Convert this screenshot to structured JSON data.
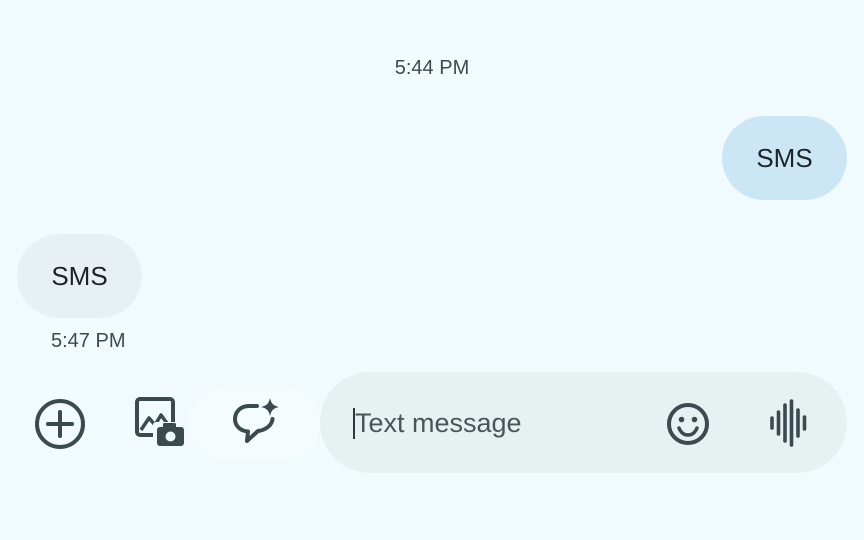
{
  "conversation": {
    "messages": [
      {
        "direction": "outgoing",
        "timestamp": "5:44 PM",
        "text": "SMS"
      },
      {
        "direction": "incoming",
        "timestamp": "5:47 PM",
        "text": "SMS"
      }
    ]
  },
  "composer": {
    "placeholder": "Text message",
    "value": ""
  },
  "icons": {
    "add": "add-circle-icon",
    "gallery": "gallery-camera-icon",
    "ai_reply": "ai-sparkle-chat-icon",
    "emoji": "emoji-icon",
    "voice": "voice-waveform-icon"
  },
  "colors": {
    "background": "#f1fbfe",
    "outgoing_bubble": "#cbe7f5",
    "incoming_bubble": "#e7f0f2",
    "composer_background": "#e8f1f2",
    "icon_color": "#3a4a4f"
  }
}
